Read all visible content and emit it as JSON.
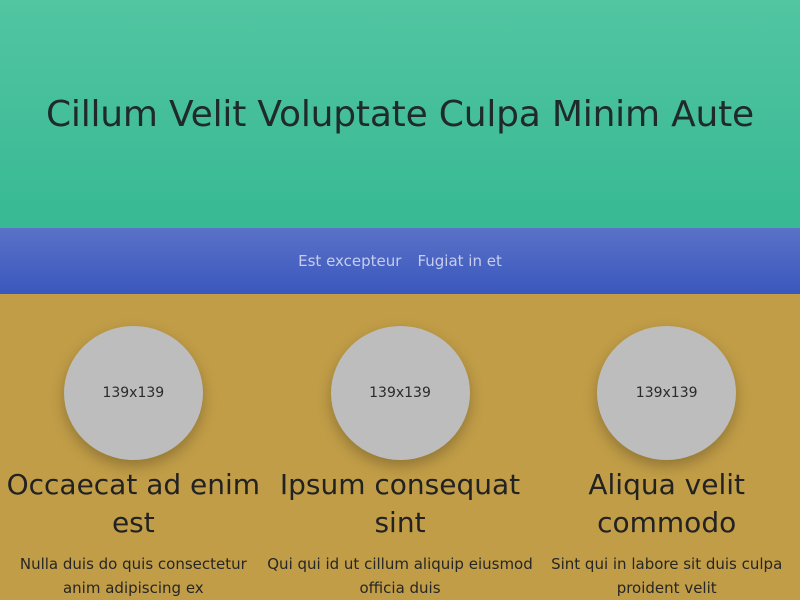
{
  "hero": {
    "title": "Cillum Velit Voluptate Culpa Minim Aute"
  },
  "nav": {
    "links": [
      "Est excepteur",
      "Fugiat in et"
    ]
  },
  "features": [
    {
      "image_label": "139x139",
      "title": "Occaecat ad enim est",
      "text": "Nulla duis do quis consectetur anim adipiscing ex"
    },
    {
      "image_label": "139x139",
      "title": "Ipsum consequat sint",
      "text": "Qui qui id ut cillum aliquip eiusmod officia duis"
    },
    {
      "image_label": "139x139",
      "title": "Aliqua velit commodo",
      "text": "Sint qui in labore sit duis culpa proident velit"
    }
  ],
  "colors": {
    "hero_bg": "#43bf9a",
    "nav_bg": "#4a64c2",
    "features_bg": "#c19d47"
  }
}
